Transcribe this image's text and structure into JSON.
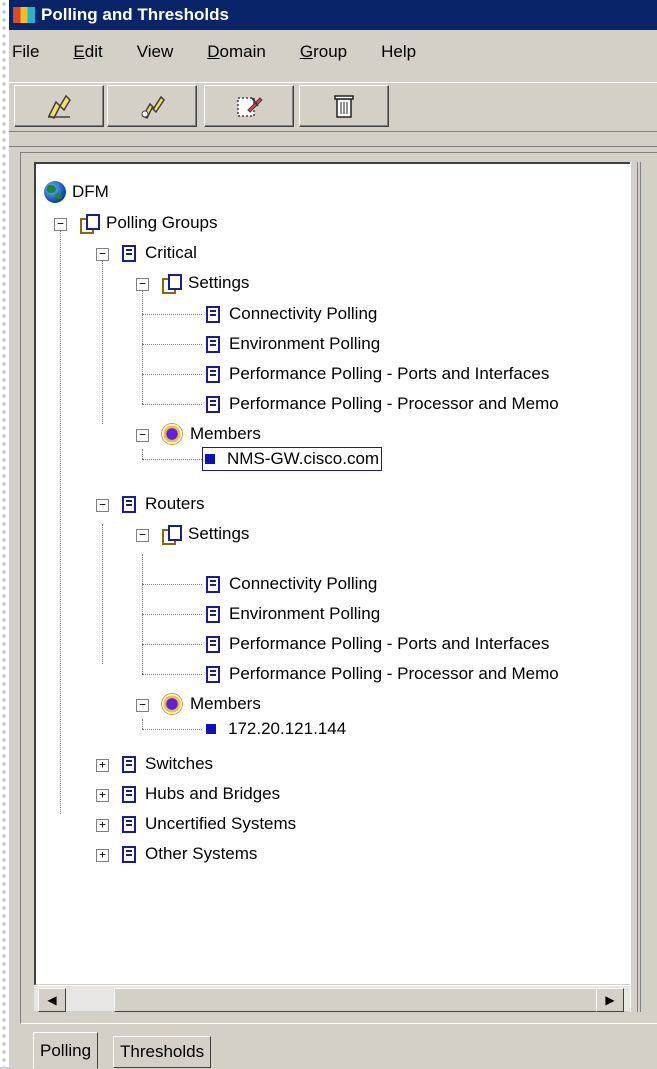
{
  "window": {
    "title": "Polling and Thresholds"
  },
  "menubar": [
    {
      "label": "File",
      "accel": ""
    },
    {
      "label": "Edit",
      "accel": "E"
    },
    {
      "label": "View",
      "accel": ""
    },
    {
      "label": "Domain",
      "accel": "D"
    },
    {
      "label": "Group",
      "accel": "G"
    },
    {
      "label": "Help",
      "accel": ""
    }
  ],
  "toolbar": {
    "buttons": [
      {
        "name": "polling-settings-icon"
      },
      {
        "name": "edit-settings-icon"
      },
      {
        "name": "edit-group-icon"
      },
      {
        "name": "trash-icon"
      }
    ]
  },
  "tree": {
    "root": "DFM",
    "polling_groups": "Polling Groups",
    "critical": "Critical",
    "critical_settings": "Settings",
    "connectivity": "Connectivity Polling",
    "environment": "Environment Polling",
    "perf_ports": "Performance Polling - Ports and Interfaces",
    "perf_proc": "Performance Polling - Processor and Memo",
    "critical_members": "Members",
    "critical_member_1": "NMS-GW.cisco.com",
    "routers": "Routers",
    "routers_settings": "Settings",
    "routers_connectivity": "Connectivity Polling",
    "routers_environment": "Environment Polling",
    "routers_perf_ports": "Performance Polling - Ports and Interfaces",
    "routers_perf_proc": "Performance Polling - Processor and Memo",
    "routers_members": "Members",
    "routers_member_1": "172.20.121.144",
    "switches": "Switches",
    "hubs": "Hubs and Bridges",
    "uncertified": "Uncertified Systems",
    "other": "Other Systems"
  },
  "tabs": [
    {
      "label": "Polling",
      "active": true
    },
    {
      "label": "Thresholds",
      "active": false
    }
  ]
}
